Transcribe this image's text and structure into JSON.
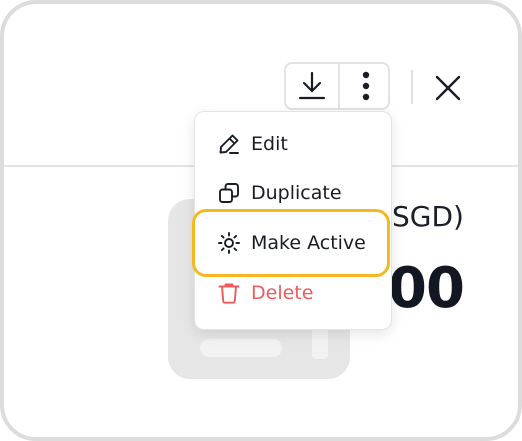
{
  "background": {
    "heading": "SGD)",
    "amount": "00"
  },
  "toolbar": {
    "download_icon": "download-icon",
    "more_icon": "more-vertical-icon",
    "close_icon": "close-icon"
  },
  "menu": {
    "items": [
      {
        "label": "Edit",
        "icon": "pencil-icon"
      },
      {
        "label": "Duplicate",
        "icon": "duplicate-icon"
      },
      {
        "label": "Make Active",
        "icon": "sun-icon",
        "highlighted": true
      },
      {
        "label": "Delete",
        "icon": "trash-icon",
        "color": "#ef5a5a"
      }
    ]
  },
  "colors": {
    "highlight": "#f5b820",
    "danger": "#ef5a5a",
    "text": "#1a1d26"
  }
}
